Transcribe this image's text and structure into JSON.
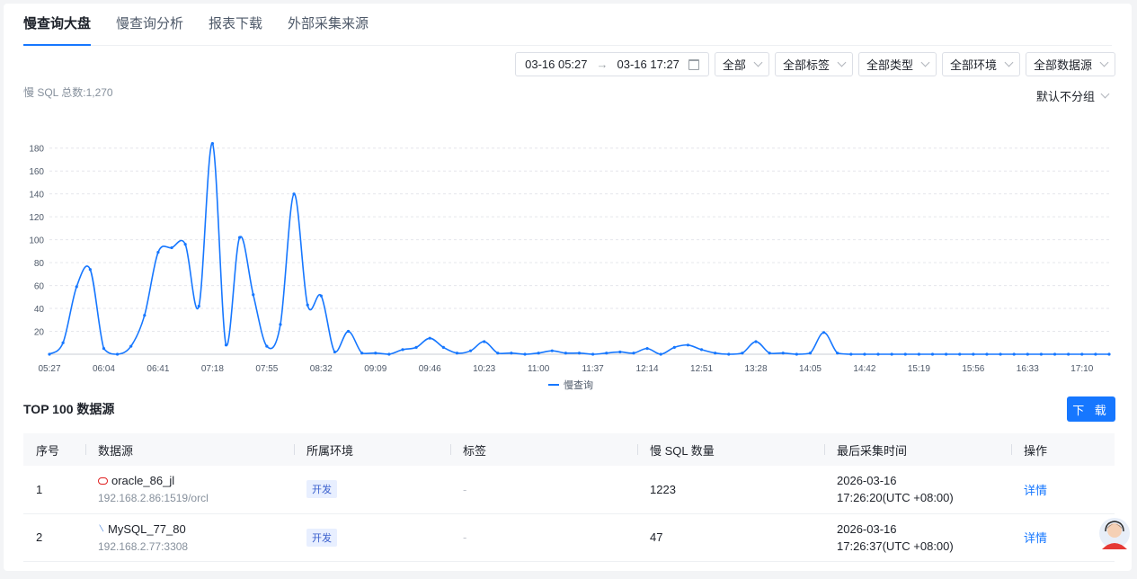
{
  "tabs": [
    {
      "label": "慢查询大盘",
      "active": true
    },
    {
      "label": "慢查询分析"
    },
    {
      "label": "报表下载"
    },
    {
      "label": "外部采集来源"
    }
  ],
  "filters": {
    "date_start": "03-16 05:27",
    "date_end": "03-16 17:27",
    "arrow": "→",
    "all": "全部",
    "tags": "全部标签",
    "types": "全部类型",
    "envs": "全部环境",
    "sources": "全部数据源"
  },
  "summary": {
    "total_label": "慢 SQL 总数:1,270",
    "group_by": "默认不分组"
  },
  "chart_data": {
    "type": "line",
    "x": [
      "05:27",
      "05:36",
      "05:45",
      "05:55",
      "06:04",
      "06:13",
      "06:22",
      "06:32",
      "06:41",
      "06:50",
      "06:59",
      "07:09",
      "07:18",
      "07:27",
      "07:36",
      "07:46",
      "07:55",
      "08:04",
      "08:13",
      "08:23",
      "08:32",
      "08:41",
      "08:50",
      "09:00",
      "09:09",
      "09:18",
      "09:27",
      "09:37",
      "09:46",
      "09:55",
      "10:04",
      "10:14",
      "10:23",
      "10:32",
      "10:41",
      "10:51",
      "11:00",
      "11:09",
      "11:18",
      "11:28",
      "11:37",
      "11:46",
      "11:55",
      "12:05",
      "12:14",
      "12:23",
      "12:32",
      "12:42",
      "12:51",
      "13:00",
      "13:09",
      "13:19",
      "13:28",
      "13:37",
      "13:46",
      "13:56",
      "14:05",
      "14:14",
      "14:23",
      "14:33",
      "14:42",
      "14:51",
      "15:00",
      "15:10",
      "15:19",
      "15:28",
      "15:37",
      "15:47",
      "15:56",
      "16:05",
      "16:14",
      "16:24",
      "16:33",
      "16:42",
      "16:51",
      "17:01",
      "17:10",
      "17:19",
      "17:27"
    ],
    "series": [
      {
        "name": "慢查询",
        "color": "#1677ff",
        "values": [
          0,
          10,
          59,
          74,
          5,
          0,
          7,
          34,
          89,
          93,
          96,
          42,
          184,
          8,
          102,
          52,
          7,
          26,
          140,
          43,
          51,
          2,
          20,
          1,
          1,
          0,
          4,
          6,
          14,
          6,
          1,
          3,
          11,
          1,
          1,
          0,
          1,
          3,
          1,
          1,
          0,
          1,
          2,
          1,
          5,
          0,
          6,
          8,
          4,
          1,
          0,
          1,
          11,
          1,
          1,
          0,
          1,
          19,
          1,
          0,
          0,
          0,
          0,
          0,
          0,
          0,
          0,
          0,
          0,
          0,
          0,
          0,
          0,
          0,
          0,
          0,
          0,
          0,
          0
        ]
      }
    ],
    "xticks": [
      "05:27",
      "06:04",
      "06:41",
      "07:18",
      "07:55",
      "08:32",
      "09:09",
      "09:46",
      "10:23",
      "11:00",
      "11:37",
      "12:14",
      "12:51",
      "13:28",
      "14:05",
      "14:42",
      "15:19",
      "15:56",
      "16:33",
      "17:10"
    ],
    "yticks": [
      20,
      40,
      60,
      80,
      100,
      120,
      140,
      160,
      180
    ],
    "ylim": [
      0,
      190
    ],
    "grid": true,
    "legend": "bottom-center"
  },
  "top": {
    "title": "TOP 100 数据源",
    "download": "下 载"
  },
  "table": {
    "headers": [
      "序号",
      "数据源",
      "所属环境",
      "标签",
      "慢 SQL 数量",
      "最后采集时间",
      "操作"
    ],
    "rows": [
      {
        "idx": "1",
        "icon": "oracle-icon",
        "name": "oracle_86_jl",
        "addr": "192.168.2.86:1519/orcl",
        "env": "开发",
        "tag": "-",
        "count": "1223",
        "date": "2026-03-16",
        "time": "17:26:20(UTC +08:00)",
        "action": "详情"
      },
      {
        "idx": "2",
        "icon": "mysql-icon",
        "name": "MySQL_77_80",
        "addr": "192.168.2.77:3308",
        "env": "开发",
        "tag": "-",
        "count": "47",
        "date": "2026-03-16",
        "time": "17:26:37(UTC +08:00)",
        "action": "详情"
      }
    ]
  }
}
